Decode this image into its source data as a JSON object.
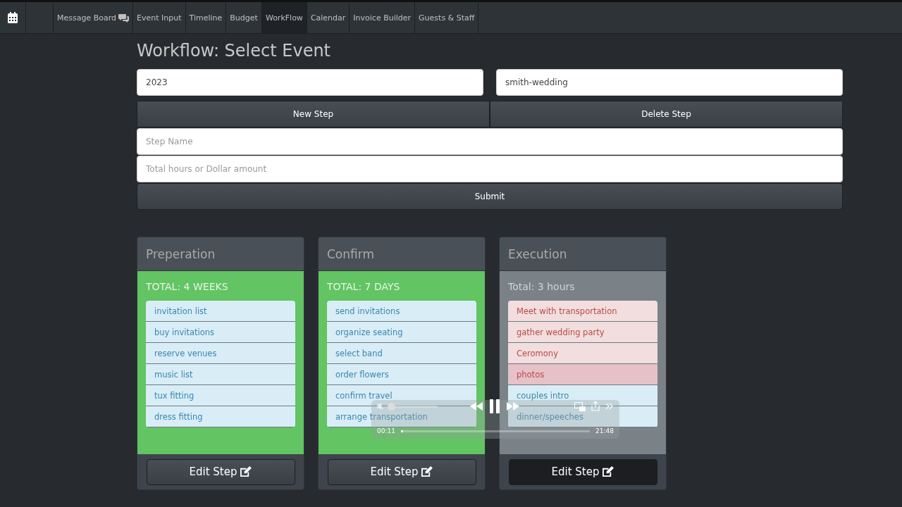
{
  "navbar": {
    "items": [
      {
        "label": "Message Board",
        "kind": "chat",
        "selected": false
      },
      {
        "label": "Event Input",
        "selected": false
      },
      {
        "label": "Timeline",
        "selected": false
      },
      {
        "label": "Budget",
        "selected": false
      },
      {
        "label": "WorkFlow",
        "selected": true
      },
      {
        "label": "Calendar",
        "selected": false
      },
      {
        "label": "Invoice Builder",
        "selected": false
      },
      {
        "label": "Guests & Staff",
        "selected": false
      }
    ]
  },
  "page_title": "Workflow: Select Event",
  "year_field": {
    "value": "2023"
  },
  "event_field": {
    "value": "smith-wedding"
  },
  "step_buttons": [
    "New Step",
    "Delete Step"
  ],
  "step_name_field": {
    "placeholder": "Step Name"
  },
  "amount_field": {
    "placeholder": "Total hours or Dollar amount"
  },
  "submit_button": "Submit",
  "workflow_cards": [
    {
      "title": "Preperation",
      "kind": "complete",
      "total": "TOTAL: 4 WEEKS",
      "edit_button": "Edit Step",
      "edit_active": false,
      "tasks": [
        {
          "label": "invitation list",
          "kind": "info",
          "hovered": false
        },
        {
          "label": "buy invitations",
          "kind": "info",
          "hovered": false
        },
        {
          "label": "reserve venues",
          "kind": "info",
          "hovered": false
        },
        {
          "label": "music list",
          "kind": "info",
          "hovered": false
        },
        {
          "label": "tux fitting",
          "kind": "info",
          "hovered": false
        },
        {
          "label": "dress fitting",
          "kind": "info",
          "hovered": false
        }
      ]
    },
    {
      "title": "Confirm",
      "kind": "complete",
      "total": "TOTAL: 7 DAYS",
      "edit_button": "Edit Step",
      "edit_active": false,
      "tasks": [
        {
          "label": "send invitations",
          "kind": "info",
          "hovered": false
        },
        {
          "label": "organize seating",
          "kind": "info",
          "hovered": false
        },
        {
          "label": "select band",
          "kind": "info",
          "hovered": false
        },
        {
          "label": "order flowers",
          "kind": "info",
          "hovered": false
        },
        {
          "label": "confirm travel",
          "kind": "info",
          "hovered": false
        },
        {
          "label": "arrange transportation",
          "kind": "info",
          "hovered": false
        }
      ]
    },
    {
      "title": "Execution",
      "kind": "pending",
      "total": "Total: 3 hours",
      "edit_button": "Edit Step",
      "edit_active": true,
      "tasks": [
        {
          "label": "Meet with transportation",
          "kind": "danger",
          "hovered": false
        },
        {
          "label": "gather wedding party",
          "kind": "danger",
          "hovered": false
        },
        {
          "label": "Ceromony",
          "kind": "danger",
          "hovered": false
        },
        {
          "label": "photos",
          "kind": "danger",
          "hovered": true
        },
        {
          "label": "couples intro",
          "kind": "info",
          "hovered": false
        },
        {
          "label": "dinner/speeches",
          "kind": "info",
          "hovered": false
        }
      ]
    }
  ],
  "video_player": {
    "elapsed": "00:11",
    "remaining": "21:48",
    "level": 0.01,
    "volume": {
      "level": 0.05
    }
  }
}
